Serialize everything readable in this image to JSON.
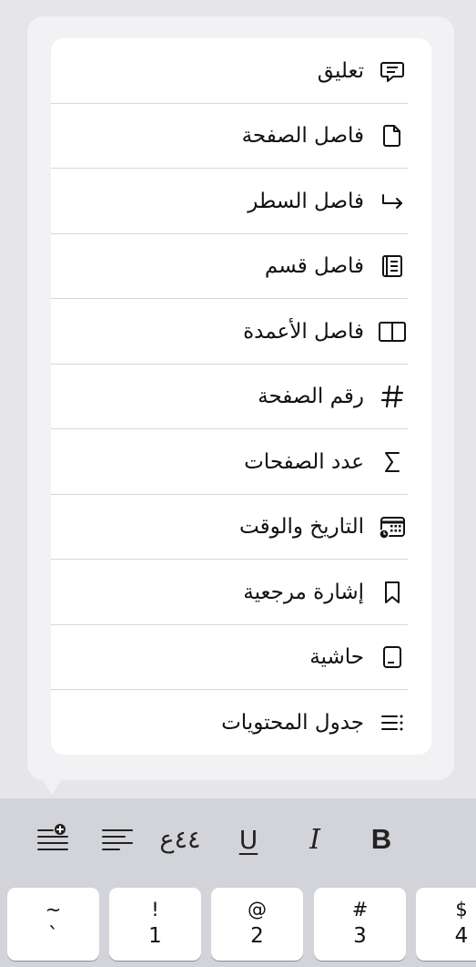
{
  "menu": {
    "items": [
      {
        "label": "تعليق",
        "icon": "comment-icon"
      },
      {
        "label": "فاصل الصفحة",
        "icon": "page-icon"
      },
      {
        "label": "فاصل السطر",
        "icon": "line-break-icon"
      },
      {
        "label": "فاصل قسم",
        "icon": "section-break-icon"
      },
      {
        "label": "فاصل الأعمدة",
        "icon": "column-break-icon"
      },
      {
        "label": "رقم الصفحة",
        "icon": "hash-icon"
      },
      {
        "label": "عدد الصفحات",
        "icon": "page-count-icon"
      },
      {
        "label": "التاريخ والوقت",
        "icon": "calendar-clock-icon"
      },
      {
        "label": "إشارة مرجعية",
        "icon": "bookmark-icon"
      },
      {
        "label": "حاشية",
        "icon": "footnote-icon"
      },
      {
        "label": "جدول المحتويات",
        "icon": "toc-icon"
      }
    ]
  },
  "toolbar": {
    "bold_label": "B",
    "italic_label": "I",
    "underline_label": "U",
    "numbers_label": "٤٤ع"
  },
  "keyboard": {
    "keys": [
      {
        "shift": "~",
        "main": "`"
      },
      {
        "shift": "!",
        "main": "1"
      },
      {
        "shift": "@",
        "main": "2"
      },
      {
        "shift": "#",
        "main": "3"
      },
      {
        "shift": "$",
        "main": "4"
      }
    ]
  }
}
